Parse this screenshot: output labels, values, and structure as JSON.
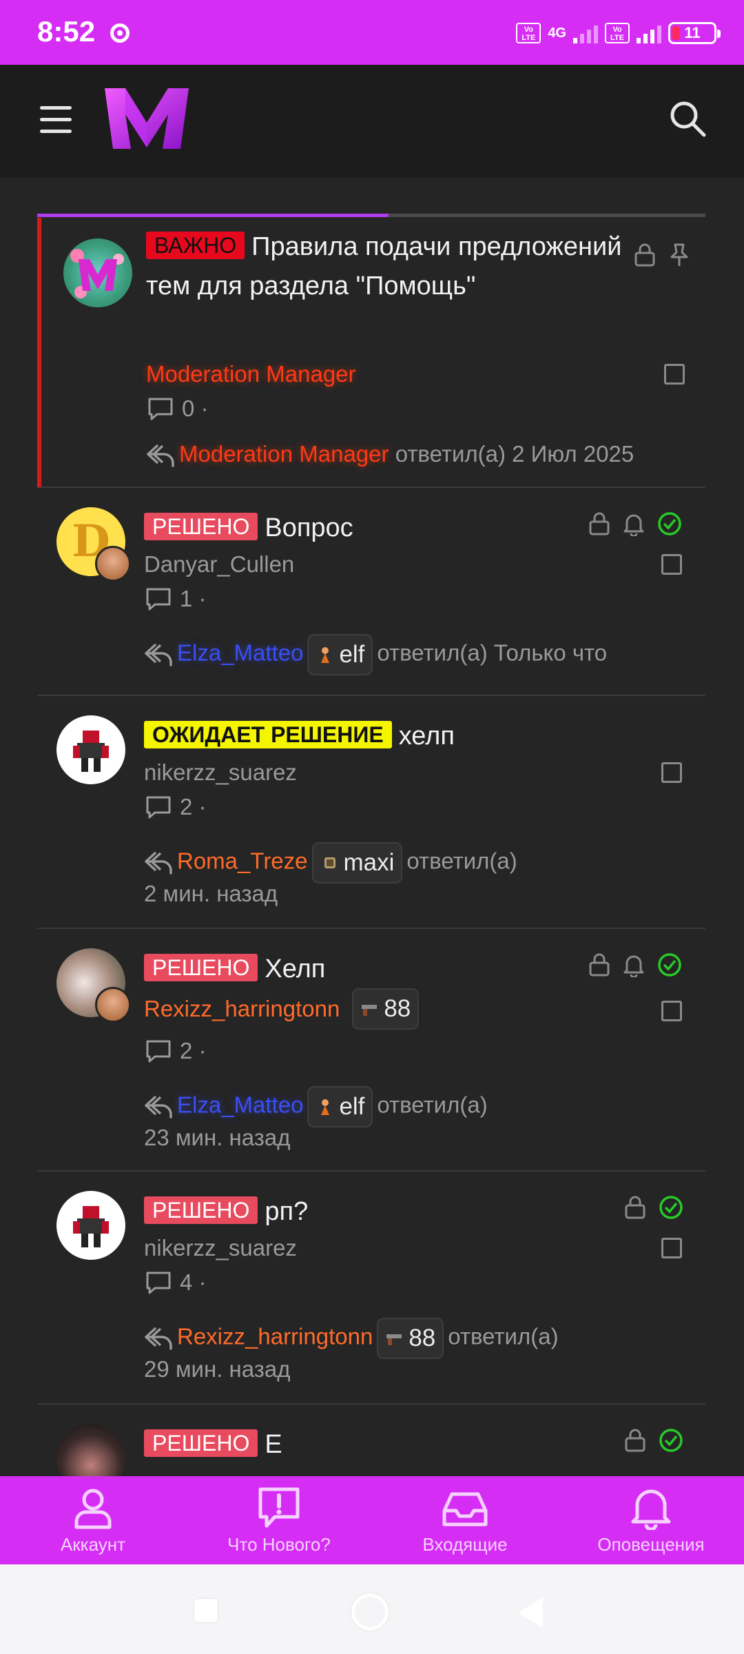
{
  "status_bar": {
    "time": "8:52",
    "network": "4G",
    "volte": "Vo LTE",
    "battery": "11"
  },
  "colors": {
    "accent": "#d62df5",
    "background": "#252525",
    "header": "#1c1c1c",
    "sticky_border": "#d41c1c"
  },
  "threads": [
    {
      "prefix": "ВАЖНО",
      "title": "Правила подачи предложений тем для раздела \"Помощь\"",
      "author": "Moderation Manager",
      "replies": "0 ·",
      "last_poster": "Moderation Manager",
      "last_text": "ответил(а) 2 Июл 2025",
      "icons": [
        "lock-icon",
        "pin-icon"
      ]
    },
    {
      "prefix": "РЕШЕНО",
      "title": "Вопрос",
      "author": "Danyar_Cullen",
      "avatar_letter": "D",
      "replies": "1 ·",
      "last_poster": "Elza_Matteo",
      "last_tag": "elf",
      "last_text": "ответил(а) Только что",
      "icons": [
        "lock-icon",
        "bell-icon",
        "check-circle-icon"
      ]
    },
    {
      "prefix": "ОЖИДАЕТ РЕШЕНИЕ",
      "title": "хелп",
      "author": "nikerzz_suarez",
      "replies": "2 ·",
      "last_poster": "Roma_Treze",
      "last_tag": "maxi",
      "last_text": "ответил(а)",
      "last_time": "2 мин. назад"
    },
    {
      "prefix": "РЕШЕНО",
      "title": "Хелп",
      "author": "Rexizz_harringtonn",
      "author_tag": "88",
      "replies": "2 ·",
      "last_poster": "Elza_Matteo",
      "last_tag": "elf",
      "last_text": "ответил(а)",
      "last_time": "23 мин. назад",
      "icons": [
        "lock-icon",
        "bell-icon",
        "check-circle-icon"
      ]
    },
    {
      "prefix": "РЕШЕНО",
      "title": "рп?",
      "author": "nikerzz_suarez",
      "replies": "4 ·",
      "last_poster": "Rexizz_harringtonn",
      "last_tag": "88",
      "last_text": "ответил(а)",
      "last_time": "29 мин. назад",
      "icons": [
        "lock-icon",
        "check-circle-icon"
      ]
    },
    {
      "prefix": "РЕШЕНО",
      "title": "Е",
      "icons": [
        "lock-icon",
        "check-circle-icon"
      ]
    }
  ],
  "bottom_nav": [
    {
      "label": "Аккаунт",
      "icon": "user-icon"
    },
    {
      "label": "Что Нового?",
      "icon": "whats-new-icon"
    },
    {
      "label": "Входящие",
      "icon": "inbox-icon"
    },
    {
      "label": "Оповещения",
      "icon": "bell-icon"
    }
  ]
}
